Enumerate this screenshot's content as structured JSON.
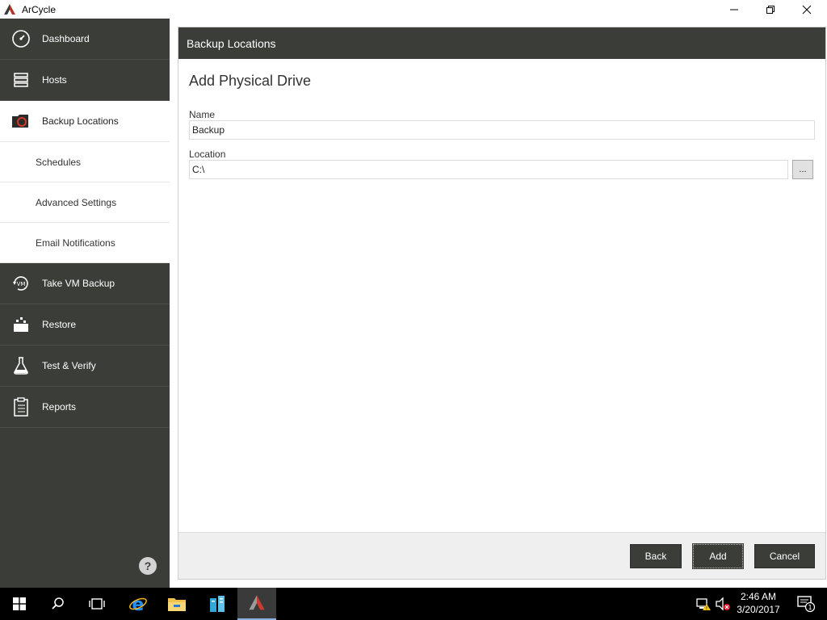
{
  "window": {
    "title": "ArCycle",
    "controls": [
      "minimize-icon",
      "restore-icon",
      "close-icon"
    ]
  },
  "sidebar": {
    "items": [
      {
        "label": "Dashboard",
        "icon": "dashboard-icon"
      },
      {
        "label": "Hosts",
        "icon": "hosts-icon"
      },
      {
        "label": "Backup Locations",
        "icon": "backup-locations-icon",
        "active": true
      },
      {
        "label": "Schedules"
      },
      {
        "label": "Advanced Settings"
      },
      {
        "label": "Email Notifications"
      },
      {
        "label": "Take VM Backup",
        "icon": "vm-backup-icon"
      },
      {
        "label": "Restore",
        "icon": "restore-icon"
      },
      {
        "label": "Test & Verify",
        "icon": "flask-icon"
      },
      {
        "label": "Reports",
        "icon": "clipboard-icon"
      }
    ],
    "help_label": "?"
  },
  "main": {
    "header": "Backup Locations",
    "title": "Add Physical Drive",
    "name_label": "Name",
    "name_value": "Backup",
    "location_label": "Location",
    "location_value": "C:\\",
    "browse_label": "...",
    "buttons": {
      "back": "Back",
      "add": "Add",
      "cancel": "Cancel"
    }
  },
  "taskbar": {
    "time": "2:46 AM",
    "date": "3/20/2017",
    "notification_count": "1",
    "apps": [
      "start-icon",
      "search-icon",
      "task-view-icon",
      "internet-explorer-icon",
      "file-explorer-icon",
      "server-manager-icon",
      "arcycle-icon"
    ]
  },
  "colors": {
    "sidebar_bg": "#3b3d39",
    "accent": "#c0392b",
    "header_bg": "#3b3d39"
  }
}
